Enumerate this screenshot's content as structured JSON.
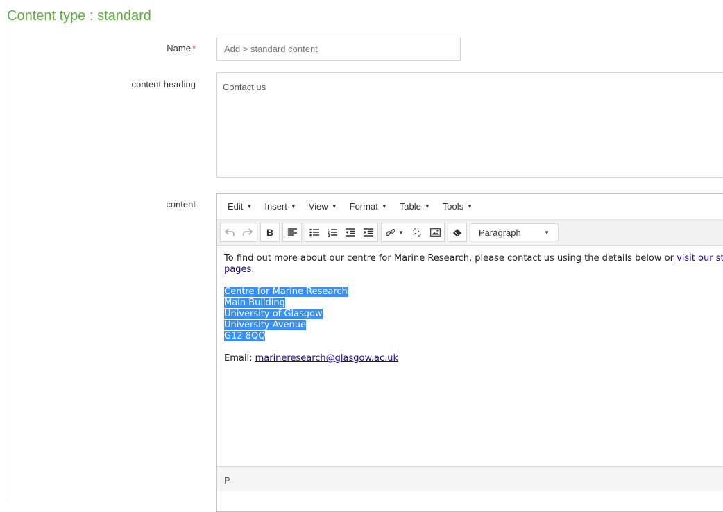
{
  "page": {
    "title": "Content type : standard"
  },
  "form": {
    "name": {
      "label": "Name",
      "required_mark": "*",
      "placeholder": "Add > standard content"
    },
    "heading": {
      "label": "content heading",
      "value": "Contact us"
    },
    "content": {
      "label": "content"
    }
  },
  "editor": {
    "menus": [
      "Edit",
      "Insert",
      "View",
      "Format",
      "Table",
      "Tools"
    ],
    "toolbar": {
      "icons": [
        "undo-icon",
        "redo-icon",
        "bold-icon",
        "align-left-icon",
        "bullet-list-icon",
        "numbered-list-icon",
        "outdent-icon",
        "indent-icon",
        "link-icon",
        "unlink-icon",
        "image-icon",
        "clear-formatting-icon"
      ],
      "bold_label": "B",
      "block_format": "Paragraph"
    },
    "body": {
      "para1_text": "To find out more about our centre for Marine Research, please contact us using the details below or ",
      "para1_link": "visit our staff pages",
      "para1_end": ".",
      "address": [
        "Centre for Marine Research",
        "Main Building",
        "University of Glasgow",
        "University Avenue",
        "G12 8QQ"
      ],
      "email_label": "Email: ",
      "email_link": "marineresearch@glasgow.ac.uk"
    },
    "status_path": "P"
  },
  "colors": {
    "title": "#5cae3a",
    "selection": "#3390ff",
    "link": "#1a0dab",
    "required": "#d9534f"
  }
}
